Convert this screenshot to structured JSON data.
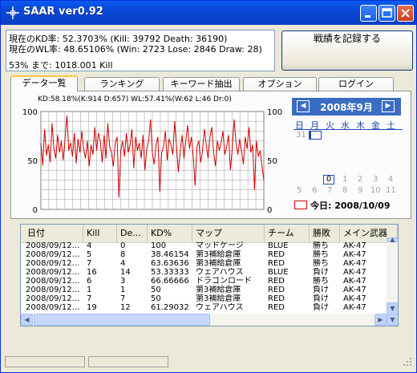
{
  "window": {
    "title": "SAAR ver0.92"
  },
  "status": {
    "kd_line": "現在のKD率: 52.3703% (Kill: 39792 Death: 36190)",
    "wl_line": "現在のWL率: 48.65106% (Win: 2723 Lose: 2846 Draw: 28)",
    "next_line": "53% まで: 1018.001 Kill"
  },
  "record_button": "戦績を記録する",
  "tabs": [
    "データ一覧",
    "ランキング",
    "キーワード抽出",
    "オプション",
    "ログイン"
  ],
  "chart_caption": "KD:58.18%(K:914 D:657) WL:57.41%(W:62 L:46 Dr:0)",
  "chart_data": {
    "type": "line",
    "ylim": [
      0,
      100
    ],
    "yticks_left": [
      "100",
      "50",
      "0"
    ],
    "yticks_right": [
      "100",
      "50",
      "0"
    ],
    "grid": true,
    "series": [
      {
        "color": "#d40000",
        "values": [
          68,
          45,
          82,
          55,
          66,
          48,
          88,
          62,
          52,
          76,
          58,
          70,
          50,
          72,
          96,
          60,
          68,
          54,
          78,
          47,
          72,
          58,
          80,
          62,
          52,
          70,
          44,
          66,
          56,
          84,
          60,
          78,
          70,
          48,
          76,
          52,
          88,
          64,
          58,
          44,
          68,
          74,
          12,
          60,
          70,
          54,
          78,
          58,
          66,
          82,
          42,
          74,
          60,
          68,
          52,
          76,
          40,
          62,
          70,
          92,
          58,
          46,
          66,
          74,
          18,
          58,
          64,
          80,
          50,
          72,
          66,
          56,
          90,
          64,
          38,
          60,
          76,
          52,
          70,
          86,
          62,
          74,
          54,
          24,
          64,
          70,
          48,
          60,
          82,
          66,
          52,
          74,
          84,
          58,
          44,
          70,
          60,
          68,
          80,
          56,
          64,
          76,
          40,
          62,
          92,
          68,
          56,
          72,
          60,
          46,
          74,
          62,
          84,
          58,
          66,
          20,
          70,
          54,
          60,
          44,
          30
        ]
      }
    ]
  },
  "calendar": {
    "title": "2008年9月",
    "prev": "◀",
    "next": "▶",
    "weekdays": [
      "日",
      "月",
      "火",
      "水",
      "木",
      "金",
      "土"
    ],
    "row1": [
      "31",
      "1"
    ],
    "row5": [
      "0",
      "1",
      "2",
      "3",
      "4"
    ],
    "row6": [
      "5",
      "6",
      "7",
      "8",
      "9",
      "10",
      "11"
    ],
    "today_label": "今日: 2008/10/09",
    "colors": {
      "header": "#3a6cc4",
      "weekday": "#2149ad",
      "today_box": "#d00000"
    }
  },
  "table": {
    "columns": [
      "日付",
      "Kill",
      "De...",
      "KD%",
      "マップ",
      "チーム",
      "勝敗",
      "メイン武器"
    ],
    "rows": [
      [
        "2008/09/12...",
        "4",
        "0",
        "100",
        "マッドケージ",
        "BLUE",
        "勝ち",
        "AK-47"
      ],
      [
        "2008/09/12...",
        "5",
        "8",
        "38.46154",
        "第3補給倉庫",
        "RED",
        "勝ち",
        "AK-47"
      ],
      [
        "2008/09/12...",
        "7",
        "4",
        "63.63636",
        "第3補給倉庫",
        "RED",
        "勝ち",
        "AK-47"
      ],
      [
        "2008/09/12...",
        "16",
        "14",
        "53.33333",
        "ウェアハウス",
        "BLUE",
        "負け",
        "AK-47"
      ],
      [
        "2008/09/12...",
        "6",
        "3",
        "66.66666",
        "ドラゴンロード",
        "RED",
        "勝ち",
        "AK-47"
      ],
      [
        "2008/09/12...",
        "1",
        "1",
        "50",
        "第3補給倉庫",
        "RED",
        "負け",
        "AK-47"
      ],
      [
        "2008/09/12...",
        "7",
        "7",
        "50",
        "第3補給倉庫",
        "RED",
        "負け",
        "AK-47"
      ],
      [
        "2008/09/12...",
        "19",
        "12",
        "61.29032",
        "ウェアハウス",
        "RED",
        "負け",
        "AK-47"
      ]
    ]
  }
}
